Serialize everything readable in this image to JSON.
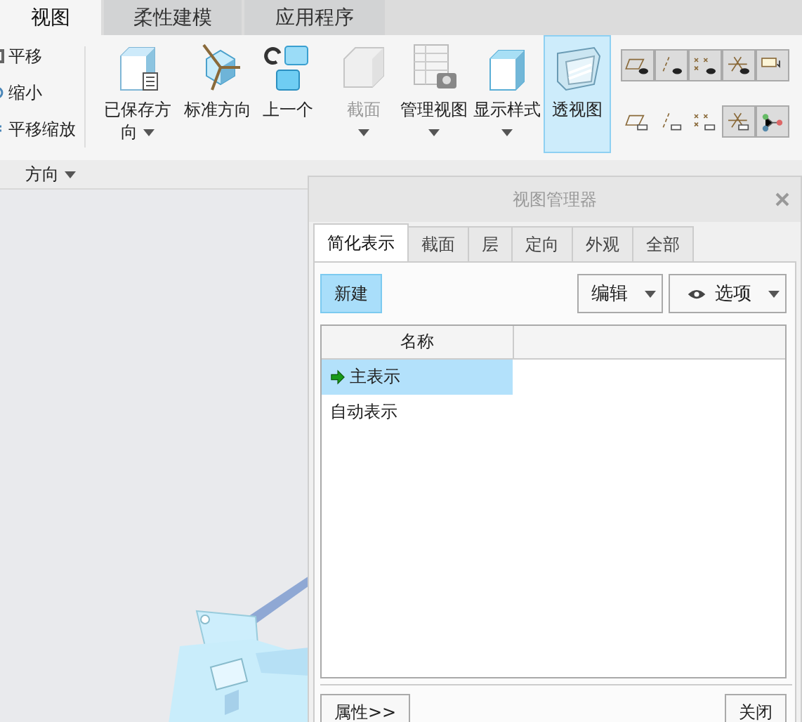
{
  "ribbon_tabs": [
    {
      "label": "视图",
      "selected": true
    },
    {
      "label": "柔性建模",
      "selected": false
    },
    {
      "label": "应用程序",
      "selected": false
    }
  ],
  "ribbon_groups": [
    {
      "label": "方向",
      "items": [
        {
          "kind": "small",
          "label": "平移"
        },
        {
          "kind": "small",
          "label": "缩小"
        },
        {
          "kind": "small",
          "label": "平移缩放"
        },
        {
          "kind": "large",
          "label": "已保存方向",
          "dropdown": true,
          "disabled": false,
          "on": false
        },
        {
          "kind": "large",
          "label": "标准方向",
          "dropdown": false,
          "disabled": false,
          "on": false
        },
        {
          "kind": "large",
          "label": "上一个",
          "dropdown": false,
          "disabled": false,
          "on": false
        }
      ]
    },
    {
      "items": [
        {
          "kind": "large",
          "label": "截面",
          "dropdown": true,
          "disabled": true,
          "on": false
        },
        {
          "kind": "large",
          "label": "管理视图",
          "dropdown": true,
          "disabled": false,
          "on": false
        },
        {
          "kind": "large",
          "label": "显示样式",
          "dropdown": true,
          "disabled": false,
          "on": false
        },
        {
          "kind": "large",
          "label": "透视图",
          "dropdown": false,
          "disabled": false,
          "on": true
        }
      ]
    },
    {
      "items": [
        {
          "kind": "toggle",
          "on": true
        },
        {
          "kind": "toggle",
          "on": true
        },
        {
          "kind": "toggle",
          "on": true
        },
        {
          "kind": "toggle",
          "on": true
        },
        {
          "kind": "toggle",
          "on": true
        },
        {
          "kind": "toggle",
          "on": false
        },
        {
          "kind": "toggle",
          "on": false
        },
        {
          "kind": "toggle",
          "on": false
        },
        {
          "kind": "toggle",
          "on": true
        },
        {
          "kind": "toggle",
          "on": true
        }
      ]
    }
  ],
  "dialog": {
    "title": "视图管理器",
    "tabs": [
      {
        "label": "简化表示",
        "selected": true
      },
      {
        "label": "截面",
        "selected": false
      },
      {
        "label": "层",
        "selected": false
      },
      {
        "label": "定向",
        "selected": false
      },
      {
        "label": "外观",
        "selected": false
      },
      {
        "label": "全部",
        "selected": false
      }
    ],
    "new_button": "新建",
    "edit_menu": "编辑",
    "options_menu": "选项",
    "columns": [
      "名称"
    ],
    "rows": [
      {
        "name": "主表示",
        "selected": true,
        "current": true
      },
      {
        "name": "自动表示",
        "selected": false,
        "current": false
      }
    ],
    "footer_buttons": [
      "属性>>",
      "关闭"
    ]
  }
}
